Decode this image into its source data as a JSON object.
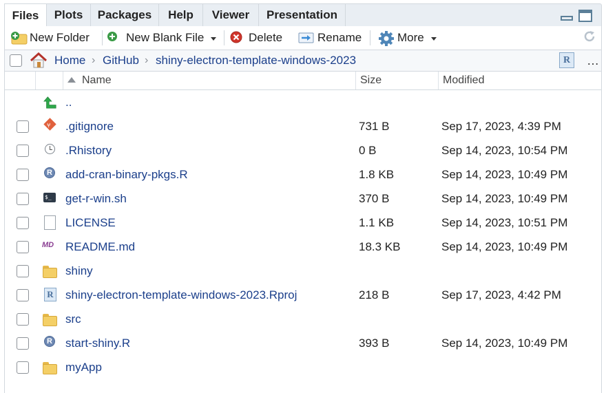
{
  "tabs": [
    {
      "label": "Files",
      "active": true
    },
    {
      "label": "Plots",
      "active": false
    },
    {
      "label": "Packages",
      "active": false
    },
    {
      "label": "Help",
      "active": false
    },
    {
      "label": "Viewer",
      "active": false
    },
    {
      "label": "Presentation",
      "active": false
    }
  ],
  "toolbar": {
    "new_folder": "New Folder",
    "new_blank_file": "New Blank File",
    "delete": "Delete",
    "rename": "Rename",
    "more": "More"
  },
  "breadcrumb": {
    "home": "Home",
    "items": [
      "GitHub",
      "shiny-electron-template-windows-2023"
    ]
  },
  "columns": {
    "name": "Name",
    "size": "Size",
    "modified": "Modified"
  },
  "parent_dir_label": "..",
  "files": [
    {
      "name": ".gitignore",
      "size": "731 B",
      "modified": "Sep 17, 2023, 4:39 PM",
      "icon": "git-icon"
    },
    {
      "name": ".Rhistory",
      "size": "0 B",
      "modified": "Sep 14, 2023, 10:54 PM",
      "icon": "history-icon"
    },
    {
      "name": "add-cran-binary-pkgs.R",
      "size": "1.8 KB",
      "modified": "Sep 14, 2023, 10:49 PM",
      "icon": "r-file-icon"
    },
    {
      "name": "get-r-win.sh",
      "size": "370 B",
      "modified": "Sep 14, 2023, 10:49 PM",
      "icon": "shell-script-icon"
    },
    {
      "name": "LICENSE",
      "size": "1.1 KB",
      "modified": "Sep 14, 2023, 10:51 PM",
      "icon": "text-file-icon"
    },
    {
      "name": "README.md",
      "size": "18.3 KB",
      "modified": "Sep 14, 2023, 10:49 PM",
      "icon": "markdown-icon"
    },
    {
      "name": "shiny",
      "size": "",
      "modified": "",
      "icon": "folder-icon"
    },
    {
      "name": "shiny-electron-template-windows-2023.Rproj",
      "size": "218 B",
      "modified": "Sep 17, 2023, 4:42 PM",
      "icon": "rproj-icon"
    },
    {
      "name": "src",
      "size": "",
      "modified": "",
      "icon": "folder-icon"
    },
    {
      "name": "start-shiny.R",
      "size": "393 B",
      "modified": "Sep 14, 2023, 10:49 PM",
      "icon": "r-file-icon"
    },
    {
      "name": "myApp",
      "size": "",
      "modified": "",
      "icon": "folder-icon"
    }
  ],
  "colors": {
    "link": "#1b3f8b",
    "tab_bg": "#e9eef3",
    "border": "#d2d8de"
  }
}
